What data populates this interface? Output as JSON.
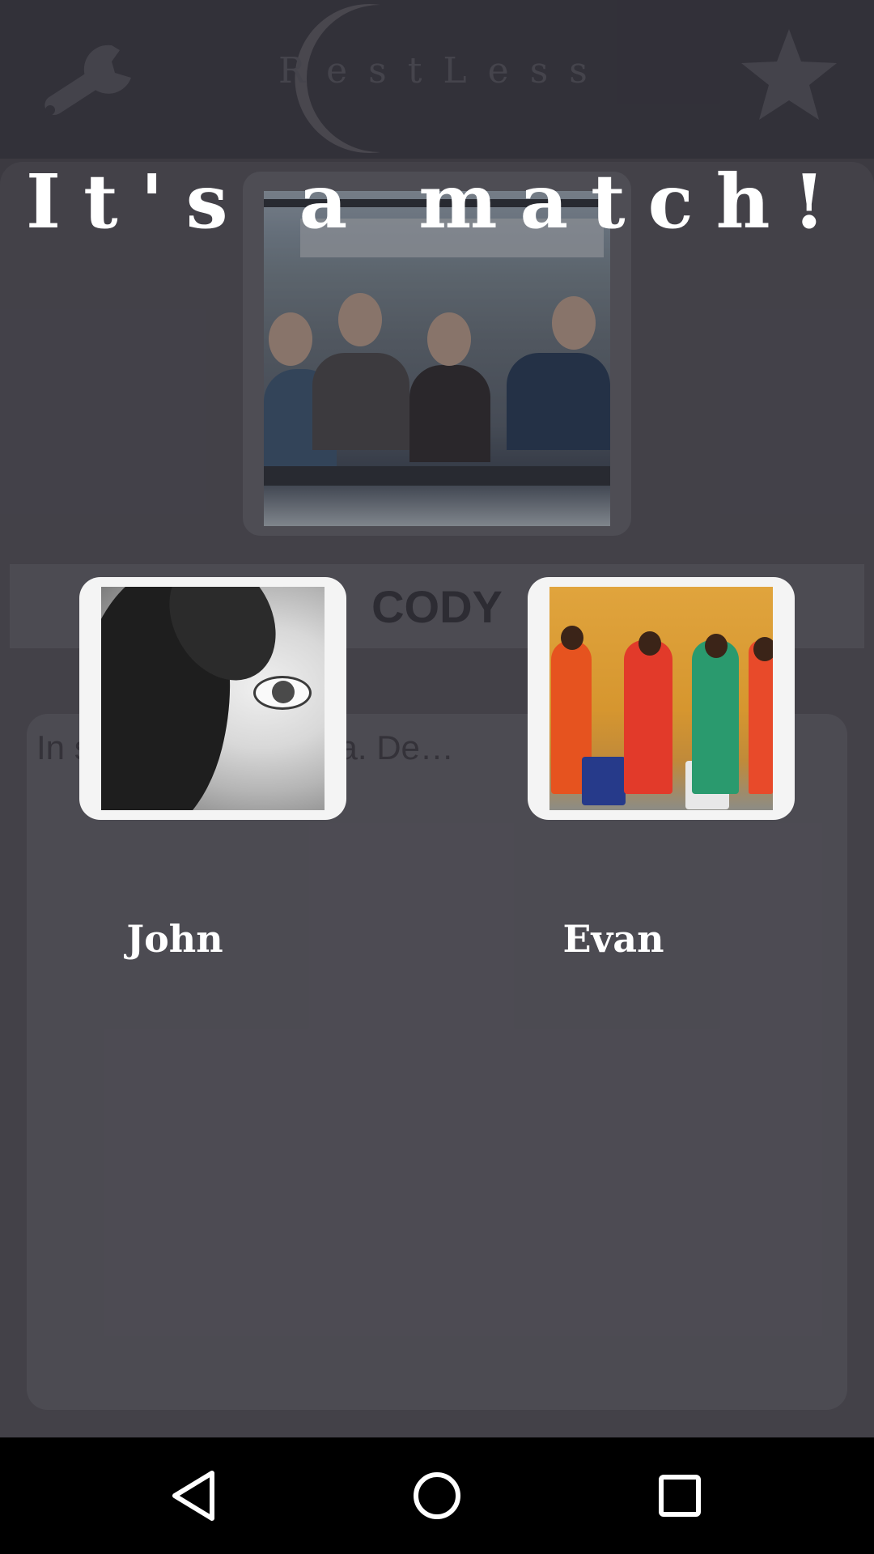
{
  "app": {
    "logo_text": "RestLess",
    "profile_name": "CODY",
    "description": "In s…nsequuntur…ta. De…",
    "icons": {
      "settings": "wrench-icon",
      "favorite": "star-icon",
      "logo": "moon-icon"
    }
  },
  "overlay": {
    "title": "It's a match!",
    "left_person": {
      "name": "John",
      "photo": "portrait-photo"
    },
    "right_person": {
      "name": "Evan",
      "photo": "group-photo"
    }
  },
  "navbar": {
    "back": "back-icon",
    "home": "home-icon",
    "recents": "recents-icon"
  },
  "colors": {
    "background": "#2a2830",
    "card": "#57555d",
    "accent_text": "#ffffff"
  }
}
